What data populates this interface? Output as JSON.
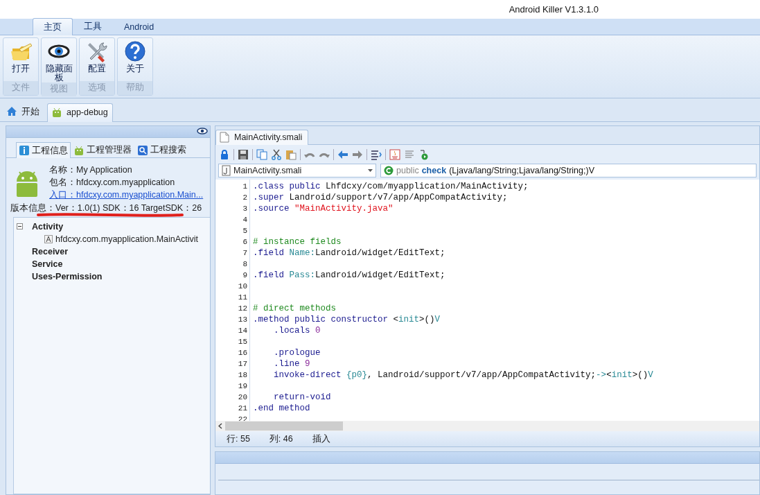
{
  "window": {
    "title": "Android Killer V1.3.1.0"
  },
  "ribbon": {
    "tabs": [
      {
        "label": "主页",
        "selected": true
      },
      {
        "label": "工具",
        "selected": false
      },
      {
        "label": "Android",
        "selected": false
      }
    ],
    "groups": [
      {
        "kind": "open",
        "button": "打开",
        "group": "文件"
      },
      {
        "kind": "eye",
        "button": "隐藏面板",
        "group": "视图"
      },
      {
        "kind": "tools",
        "button": "配置",
        "group": "选项"
      },
      {
        "kind": "help",
        "button": "关于",
        "group": "帮助"
      }
    ]
  },
  "doc_tabs": [
    {
      "kind": "home",
      "label": "开始",
      "selected": false
    },
    {
      "kind": "android",
      "label": "app-debug",
      "selected": true
    }
  ],
  "project_panel": {
    "tabs": [
      {
        "kind": "info",
        "label": "工程信息",
        "selected": true
      },
      {
        "kind": "android",
        "label": "工程管理器",
        "selected": false
      },
      {
        "kind": "search",
        "label": "工程搜索",
        "selected": false
      }
    ],
    "name": "名称：My Application",
    "package": "包名：hfdcxy.com.myapplication",
    "entry": "入口：hfdcxy.com.myapplication.Main...",
    "version": "版本信息：Ver：1.0(1) SDK：16 TargetSDK：26",
    "tree": [
      {
        "label": "Activity",
        "expanded": true,
        "children": [
          {
            "label": "hfdcxy.com.myapplication.MainActivit"
          }
        ]
      },
      {
        "label": "Receiver"
      },
      {
        "label": "Service"
      },
      {
        "label": "Uses-Permission"
      }
    ]
  },
  "editor": {
    "tabs": [
      {
        "label": "MainActivity.smali",
        "selected": true
      }
    ],
    "file_combo": "MainActivity.smali",
    "method_combo": [
      {
        "text": "public",
        "kind": "modifier"
      },
      {
        "text": "check",
        "kind": "name"
      },
      {
        "text": "(Ljava/lang/String;Ljava/lang/String;)V",
        "kind": "plain"
      }
    ],
    "lines": [
      {
        "number": "1",
        "segments": [
          {
            "text": ".class public",
            "kind": "keyword"
          },
          {
            "text": " Lhfdcxy/com/myapplication/MainActivity;",
            "kind": "plain"
          }
        ]
      },
      {
        "number": "2",
        "segments": [
          {
            "text": ".super",
            "kind": "keyword"
          },
          {
            "text": " Landroid/support/v7/app/AppCompatActivity;",
            "kind": "plain"
          }
        ]
      },
      {
        "number": "3",
        "segments": [
          {
            "text": ".source",
            "kind": "keyword"
          },
          {
            "text": " \"MainActivity.java\"",
            "kind": "string"
          }
        ]
      },
      {
        "number": "4"
      },
      {
        "number": "5"
      },
      {
        "number": "6",
        "segments": [
          {
            "text": "# instance fields",
            "kind": "comment"
          }
        ]
      },
      {
        "number": "7",
        "segments": [
          {
            "text": ".field",
            "kind": "keyword"
          },
          {
            "text": " Name:",
            "kind": "member"
          },
          {
            "text": "Landroid/widget/EditText;",
            "kind": "plain"
          }
        ]
      },
      {
        "number": "8"
      },
      {
        "number": "9",
        "segments": [
          {
            "text": ".field",
            "kind": "keyword"
          },
          {
            "text": " Pass:",
            "kind": "member"
          },
          {
            "text": "Landroid/widget/EditText;",
            "kind": "plain"
          }
        ]
      },
      {
        "number": "10"
      },
      {
        "number": "11"
      },
      {
        "number": "12",
        "segments": [
          {
            "text": "# direct methods",
            "kind": "comment"
          }
        ]
      },
      {
        "number": "13",
        "segments": [
          {
            "text": ".method public constructor",
            "kind": "keyword"
          },
          {
            "text": " <",
            "kind": "plain"
          },
          {
            "text": "init",
            "kind": "member"
          },
          {
            "text": ">()",
            "kind": "plain"
          },
          {
            "text": "V",
            "kind": "member"
          }
        ],
        "children": [
          {
            "number": "14",
            "segments": [
              {
                "text": ".locals",
                "kind": "keyword"
              },
              {
                "text": " 0",
                "kind": "number"
              }
            ]
          },
          {
            "number": "15"
          },
          {
            "number": "16",
            "segments": [
              {
                "text": ".prologue",
                "kind": "keyword"
              }
            ]
          },
          {
            "number": "17",
            "segments": [
              {
                "text": ".line",
                "kind": "keyword"
              },
              {
                "text": " 9",
                "kind": "number"
              }
            ]
          },
          {
            "number": "18",
            "segments": [
              {
                "text": "invoke-direct",
                "kind": "keyword"
              },
              {
                "text": " {p0}",
                "kind": "member"
              },
              {
                "text": ", Landroid/support/v7/app/AppCompatActivity;",
                "kind": "plain"
              },
              {
                "text": "->",
                "kind": "member"
              },
              {
                "text": "<",
                "kind": "plain"
              },
              {
                "text": "init",
                "kind": "member"
              },
              {
                "text": ">()",
                "kind": "plain"
              },
              {
                "text": "V",
                "kind": "member"
              }
            ]
          },
          {
            "number": "19"
          },
          {
            "number": "20",
            "segments": [
              {
                "text": "return-void",
                "kind": "keyword"
              }
            ]
          }
        ]
      },
      {
        "number": "21",
        "segments": [
          {
            "text": ".end method",
            "kind": "keyword"
          }
        ]
      },
      {
        "number": "22"
      }
    ],
    "status": {
      "line": "行: 55",
      "column": "列: 46",
      "mode": "插入"
    }
  }
}
